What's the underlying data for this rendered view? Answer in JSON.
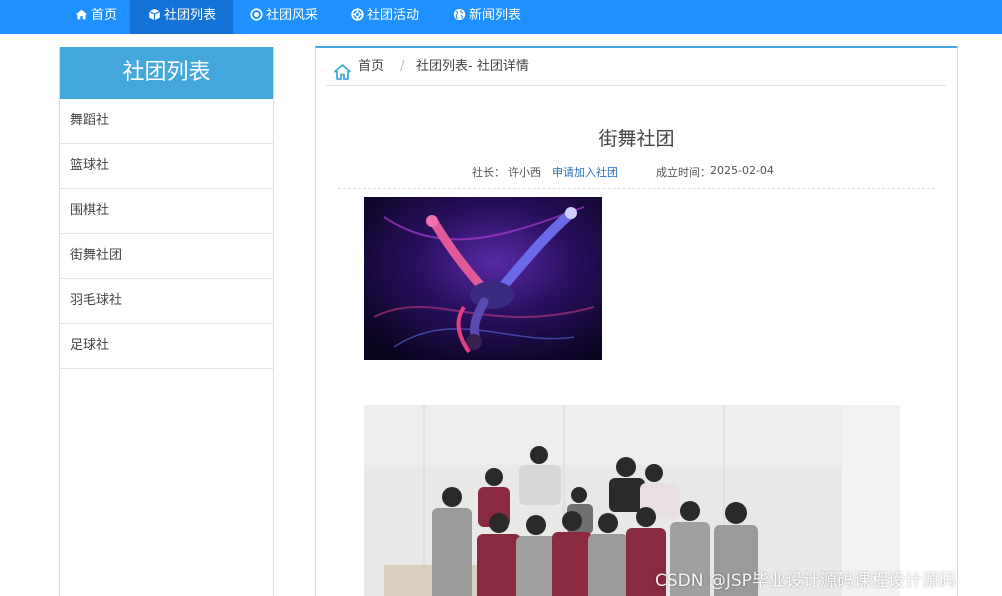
{
  "nav": {
    "items": [
      {
        "label": "首页",
        "icon": "home-icon"
      },
      {
        "label": "社团列表",
        "icon": "cube-icon"
      },
      {
        "label": "社团风采",
        "icon": "target-icon"
      },
      {
        "label": "社团活动",
        "icon": "lifebuoy-icon"
      },
      {
        "label": "新闻列表",
        "icon": "globe-icon"
      }
    ],
    "active_index": 1
  },
  "sidebar": {
    "title": "社团列表",
    "items": [
      "舞蹈社",
      "篮球社",
      "围棋社",
      "街舞社团",
      "羽毛球社",
      "足球社"
    ]
  },
  "breadcrumb": {
    "home": "首页",
    "separator": "/",
    "current": "社团列表- 社团详情"
  },
  "club": {
    "name": "街舞社团",
    "leader_label": "社长：",
    "leader": "许小西",
    "join_link": "申请加入社团",
    "founded_label": "成立时间：",
    "founded": "2025-02-04"
  },
  "watermark": "CSDN @JSP毕业设计源码课程设计源码",
  "colors": {
    "nav_bg": "#1e90ff",
    "nav_active": "#1473d6",
    "sidebar_head": "#45a8dc",
    "link": "#2a6fb8"
  }
}
